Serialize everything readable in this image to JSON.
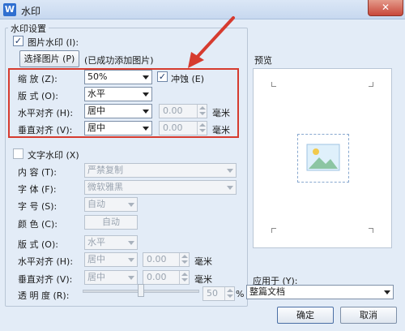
{
  "window": {
    "title": "水印",
    "app_icon": "W",
    "close_icon": "✕"
  },
  "watermark_settings": {
    "group_title": "水印设置"
  },
  "picture": {
    "checkbox_label": "图片水印 (I):",
    "checked": true,
    "choose_button": "选择图片 (P)",
    "added_status": "(已成功添加图片)",
    "scale_label": "缩    放 (Z):",
    "scale_value": "50%",
    "washout_label": "冲蚀 (E)",
    "washout_checked": true,
    "layout_label": "版    式 (O):",
    "layout_value": "水平",
    "halign_label": "水平对齐 (H):",
    "halign_value": "居中",
    "halign_offset": "0.00",
    "valign_label": "垂直对齐 (V):",
    "valign_value": "居中",
    "valign_offset": "0.00",
    "unit": "毫米"
  },
  "preview": {
    "label": "预览"
  },
  "text": {
    "checkbox_label": "文字水印 (X)",
    "checked": false,
    "content_label": "内    容 (T):",
    "content_value": "严禁复制",
    "font_label": "字    体 (F):",
    "font_value": "微软雅黑",
    "size_label": "字    号 (S):",
    "size_value": "自动",
    "color_label": "颜    色 (C):",
    "color_value": "自动",
    "layout_label": "版    式 (O):",
    "layout_value": "水平",
    "halign_label": "水平对齐 (H):",
    "halign_value": "居中",
    "halign_offset": "0.00",
    "valign_label": "垂直对齐 (V):",
    "valign_value": "居中",
    "valign_offset": "0.00",
    "unit": "毫米",
    "transparency_label": "透 明 度 (R):",
    "transparency_value": "50",
    "transparency_percent": 50,
    "percent_sign": "%"
  },
  "apply": {
    "label": "应用于 (Y):",
    "value": "整篇文档"
  },
  "buttons": {
    "ok": "确定",
    "cancel": "取消"
  },
  "colors": {
    "highlight": "#d63b2f",
    "accent": "#2f6fd0"
  }
}
